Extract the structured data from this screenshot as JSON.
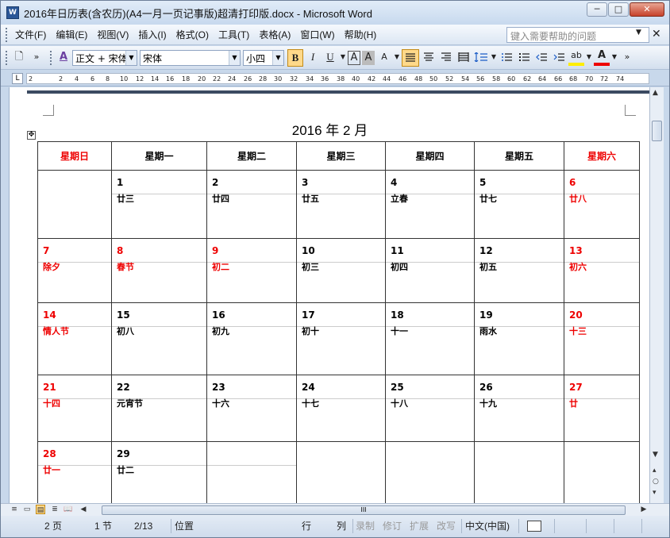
{
  "window": {
    "title": "2016年日历表(含农历)(A4一月一页记事版)超清打印版.docx - Microsoft Word",
    "app_icon": "W",
    "minimize": "─",
    "maximize": "□",
    "close": "✕"
  },
  "menu": {
    "items": [
      "文件(F)",
      "编辑(E)",
      "视图(V)",
      "插入(I)",
      "格式(O)",
      "工具(T)",
      "表格(A)",
      "窗口(W)",
      "帮助(H)"
    ],
    "help_placeholder": "键入需要帮助的问题",
    "help_dropdown": "▼",
    "doc_close": "✕"
  },
  "toolbar": {
    "new_icon": "🗋",
    "style_icon": "A",
    "style_value": "正文 + 宋体",
    "font_value": "宋体",
    "size_value": "小四",
    "bold": "B",
    "italic": "I",
    "underline": "U",
    "border_char": "A",
    "shade_char": "A",
    "scale_char": "A",
    "highlight": "ab",
    "fontcolor": "A",
    "overflow": "»"
  },
  "ruler": {
    "tab_selector": "L",
    "numbers": [
      "2",
      "2",
      "4",
      "6",
      "8",
      "10",
      "12",
      "14",
      "16",
      "18",
      "20",
      "22",
      "24",
      "26",
      "28",
      "30",
      "32",
      "34",
      "36",
      "38",
      "40",
      "42",
      "44",
      "46",
      "48",
      "50",
      "52",
      "54",
      "56",
      "58",
      "60",
      "62",
      "64",
      "66",
      "68",
      "70",
      "72",
      "74"
    ]
  },
  "calendar": {
    "title": "2016 年 2 月",
    "move_handle": "✥",
    "weekdays": [
      {
        "label": "星期日",
        "weekend": true
      },
      {
        "label": "星期一",
        "weekend": false
      },
      {
        "label": "星期二",
        "weekend": false
      },
      {
        "label": "星期三",
        "weekend": false
      },
      {
        "label": "星期四",
        "weekend": false
      },
      {
        "label": "星期五",
        "weekend": false
      },
      {
        "label": "星期六",
        "weekend": true
      }
    ],
    "weeks": [
      [
        {
          "day": "",
          "lunar": "",
          "red": false
        },
        {
          "day": "1",
          "lunar": "廿三",
          "red": false
        },
        {
          "day": "2",
          "lunar": "廿四",
          "red": false
        },
        {
          "day": "3",
          "lunar": "廿五",
          "red": false
        },
        {
          "day": "4",
          "lunar": "立春",
          "red": false
        },
        {
          "day": "5",
          "lunar": "廿七",
          "red": false
        },
        {
          "day": "6",
          "lunar": "廿八",
          "red": true
        }
      ],
      [
        {
          "day": "7",
          "lunar": "除夕",
          "red": true
        },
        {
          "day": "8",
          "lunar": "春节",
          "red": true
        },
        {
          "day": "9",
          "lunar": "初二",
          "red": true
        },
        {
          "day": "10",
          "lunar": "初三",
          "red": false
        },
        {
          "day": "11",
          "lunar": "初四",
          "red": false
        },
        {
          "day": "12",
          "lunar": "初五",
          "red": false
        },
        {
          "day": "13",
          "lunar": "初六",
          "red": true
        }
      ],
      [
        {
          "day": "14",
          "lunar": "情人节",
          "red": true
        },
        {
          "day": "15",
          "lunar": "初八",
          "red": false
        },
        {
          "day": "16",
          "lunar": "初九",
          "red": false
        },
        {
          "day": "17",
          "lunar": "初十",
          "red": false
        },
        {
          "day": "18",
          "lunar": "十一",
          "red": false
        },
        {
          "day": "19",
          "lunar": "雨水",
          "red": false
        },
        {
          "day": "20",
          "lunar": "十三",
          "red": true
        }
      ],
      [
        {
          "day": "21",
          "lunar": "十四",
          "red": true
        },
        {
          "day": "22",
          "lunar": "元宵节",
          "red": false
        },
        {
          "day": "23",
          "lunar": "十六",
          "red": false
        },
        {
          "day": "24",
          "lunar": "十七",
          "red": false
        },
        {
          "day": "25",
          "lunar": "十八",
          "red": false
        },
        {
          "day": "26",
          "lunar": "十九",
          "red": false
        },
        {
          "day": "27",
          "lunar": "廿",
          "red": true
        }
      ],
      [
        {
          "day": "28",
          "lunar": "廿一",
          "red": true
        },
        {
          "day": "29",
          "lunar": "廿二",
          "red": false
        },
        {
          "day": "",
          "lunar": "",
          "red": false
        },
        {
          "day": "",
          "lunar": "",
          "red": false
        },
        {
          "day": "",
          "lunar": "",
          "red": false
        },
        {
          "day": "",
          "lunar": "",
          "red": false
        },
        {
          "day": "",
          "lunar": "",
          "red": false
        }
      ]
    ]
  },
  "scroll": {
    "up": "▲",
    "down": "▼",
    "prev_page": "▴",
    "select_browse": "○",
    "next_page": "▾",
    "left": "◀",
    "right": "▶",
    "grip": "III"
  },
  "views": [
    "≡",
    "▭",
    "▤",
    "≣",
    "📖"
  ],
  "status": {
    "page": "2 页",
    "section": "1 节",
    "pages": "2/13",
    "position": "位置",
    "line": "行",
    "column": "列",
    "rec": "录制",
    "trk": "修订",
    "ext": "扩展",
    "ovr": "改写",
    "language": "中文(中国)"
  },
  "colors": {
    "weekend_red": "#e00000",
    "window_blue": "#c8d8eb",
    "active_button": "#ffd98a"
  }
}
